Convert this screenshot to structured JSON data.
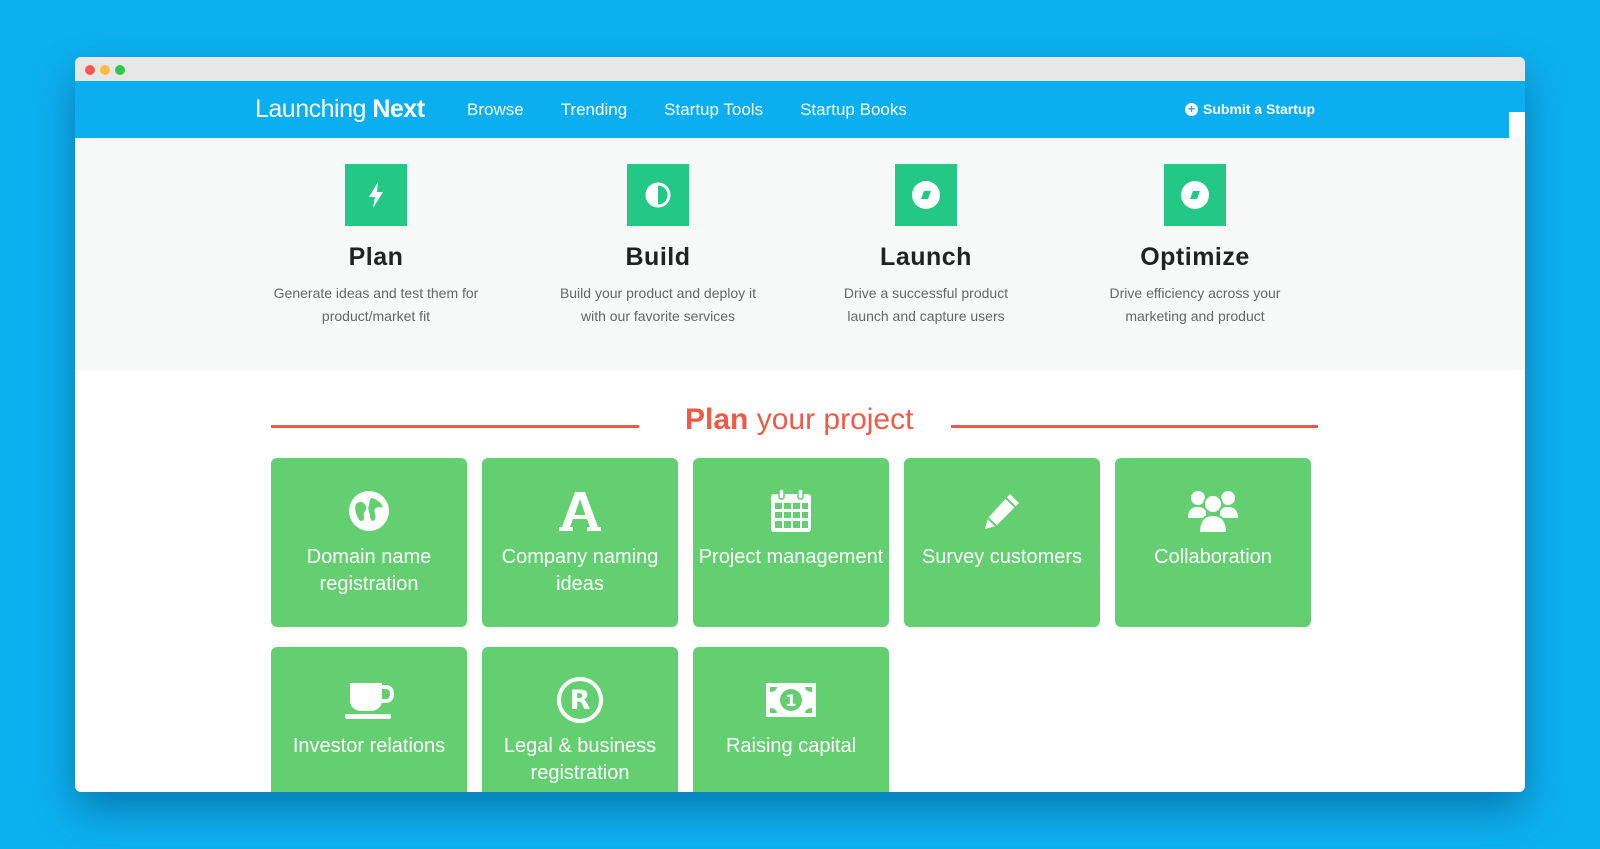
{
  "brand": {
    "light": "Launching ",
    "bold": "Next"
  },
  "nav": [
    {
      "label": "Browse"
    },
    {
      "label": "Trending"
    },
    {
      "label": "Startup Tools"
    },
    {
      "label": "Startup Books"
    }
  ],
  "submit_label": "Submit a Startup",
  "features": [
    {
      "title": "Plan",
      "desc1": "Generate ideas and test them for",
      "desc2": "product/market fit",
      "icon": "bolt-icon"
    },
    {
      "title": "Build",
      "desc1": "Build your product and deploy it",
      "desc2": "with our favorite services",
      "icon": "contrast-icon"
    },
    {
      "title": "Launch",
      "desc1": "Drive a successful product",
      "desc2": "launch and capture users",
      "icon": "compass-icon"
    },
    {
      "title": "Optimize",
      "desc1": "Drive efficiency across your",
      "desc2": "marketing and product",
      "icon": "compass-icon"
    }
  ],
  "section": {
    "bold": "Plan",
    "light": " your project"
  },
  "tiles": [
    {
      "line1": "Domain name",
      "line2": "registration",
      "icon": "globe-icon"
    },
    {
      "line1": "Company naming",
      "line2": "ideas",
      "icon": "font-icon"
    },
    {
      "line1": "Project management",
      "line2": "",
      "icon": "calendar-icon"
    },
    {
      "line1": "Survey customers",
      "line2": "",
      "icon": "pencil-icon"
    },
    {
      "line1": "Collaboration",
      "line2": "",
      "icon": "users-icon"
    },
    {
      "line1": "Investor relations",
      "line2": "",
      "icon": "coffee-icon"
    },
    {
      "line1": "Legal & business",
      "line2": "registration",
      "icon": "registered-icon"
    },
    {
      "line1": "Raising capital",
      "line2": "",
      "icon": "money-icon"
    }
  ],
  "colors": {
    "background": "#0db0ee",
    "navbar": "#0baeee",
    "feature_icon": "#23c786",
    "tile": "#63cf71",
    "accent": "#ef5a47"
  }
}
